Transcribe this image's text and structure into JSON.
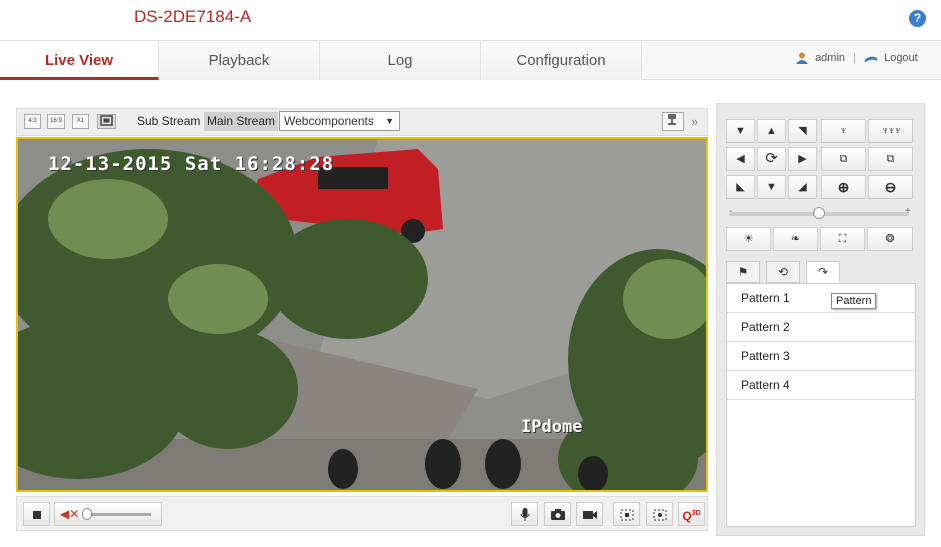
{
  "header": {
    "device_title": "DS-2DE7184-A",
    "help_icon": "?"
  },
  "nav": {
    "tabs": [
      "Live View",
      "Playback",
      "Log",
      "Configuration"
    ],
    "active": "Live View"
  },
  "user": {
    "name": "admin",
    "separator": "|",
    "logout": "Logout"
  },
  "toolbar": {
    "ratio_buttons": [
      "4:3",
      "16:9",
      "X1"
    ],
    "sub_stream": "Sub Stream",
    "main_stream": "Main Stream",
    "plugin": "Webcomponents",
    "more": "»"
  },
  "video": {
    "osd_time": "12-13-2015 Sat 16:28:28",
    "osd_name": "IPdome"
  },
  "bottom_bar": {
    "stop_icon": "stop-icon",
    "volume_icon": "mute-icon",
    "volume_level": 0.05
  },
  "ptz": {
    "directions": [
      "▼",
      "▲",
      "◥",
      "◀",
      "⟳",
      "▶",
      "◣",
      "▼",
      "◢"
    ],
    "speed_level": 0.5,
    "tabs": [
      "preset-icon",
      "patrol-icon",
      "pattern-icon"
    ],
    "active_tab": "pattern-icon",
    "patterns": [
      "Pattern 1",
      "Pattern 2",
      "Pattern 3",
      "Pattern 4"
    ],
    "tooltip": "Pattern"
  },
  "colors": {
    "accent": "#b02a24",
    "video_border": "#e6c200"
  }
}
